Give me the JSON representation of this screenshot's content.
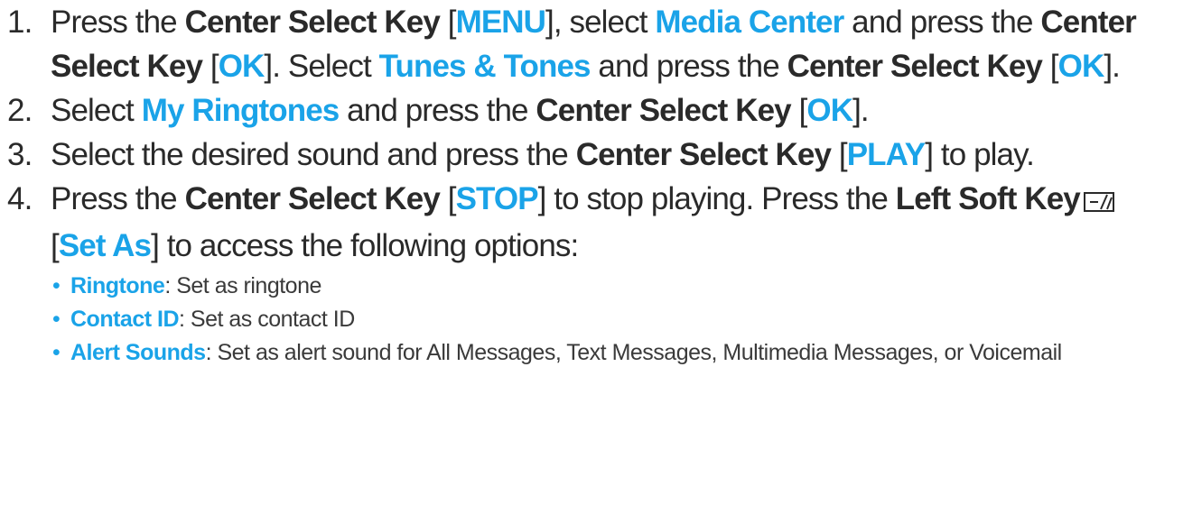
{
  "colors": {
    "highlight": "#1aa3e8",
    "text": "#2a2a2a"
  },
  "steps": [
    {
      "number": "1.",
      "parts": [
        {
          "t": "Press the "
        },
        {
          "t": "Center Select Key",
          "s": "bold"
        },
        {
          "t": " ["
        },
        {
          "t": "MENU",
          "s": "hl"
        },
        {
          "t": "], select "
        },
        {
          "t": "Media Center",
          "s": "hl"
        },
        {
          "t": " and press the "
        },
        {
          "t": "Center Select Key",
          "s": "bold"
        },
        {
          "t": " ["
        },
        {
          "t": "OK",
          "s": "hl"
        },
        {
          "t": "]. Select "
        },
        {
          "t": "Tunes & Tones",
          "s": "hl"
        },
        {
          "t": " and press the "
        },
        {
          "t": "Center Select Key",
          "s": "bold"
        },
        {
          "t": " ["
        },
        {
          "t": "OK",
          "s": "hl"
        },
        {
          "t": "]."
        }
      ]
    },
    {
      "number": "2.",
      "parts": [
        {
          "t": "Select "
        },
        {
          "t": "My Ringtones",
          "s": "hl"
        },
        {
          "t": " and press the "
        },
        {
          "t": "Center Select Key",
          "s": "bold"
        },
        {
          "t": " ["
        },
        {
          "t": "OK",
          "s": "hl"
        },
        {
          "t": "]."
        }
      ]
    },
    {
      "number": "3.",
      "parts": [
        {
          "t": "Select the desired sound and press the "
        },
        {
          "t": "Center Select Key",
          "s": "bold"
        },
        {
          "t": " ["
        },
        {
          "t": "PLAY",
          "s": "hl"
        },
        {
          "t": "] to play."
        }
      ]
    },
    {
      "number": "4.",
      "parts": [
        {
          "t": "Press the "
        },
        {
          "t": "Center Select Key",
          "s": "bold"
        },
        {
          "t": " ["
        },
        {
          "t": "STOP",
          "s": "hl"
        },
        {
          "t": "] to stop playing. Press the "
        },
        {
          "t": "Left Soft Key",
          "s": "bold"
        },
        {
          "icon": "left-soft-key-icon"
        },
        {
          "t": " ["
        },
        {
          "t": "Set As",
          "s": "hl"
        },
        {
          "t": "] to access the following options:"
        }
      ],
      "bullets": [
        {
          "term": "Ringtone",
          "desc": ": Set as ringtone"
        },
        {
          "term": "Contact ID",
          "desc": ": Set as contact ID"
        },
        {
          "term": "Alert Sounds",
          "desc": ": Set as alert sound for All Messages, Text Messages, Multimedia Messages, or Voicemail"
        }
      ]
    }
  ]
}
